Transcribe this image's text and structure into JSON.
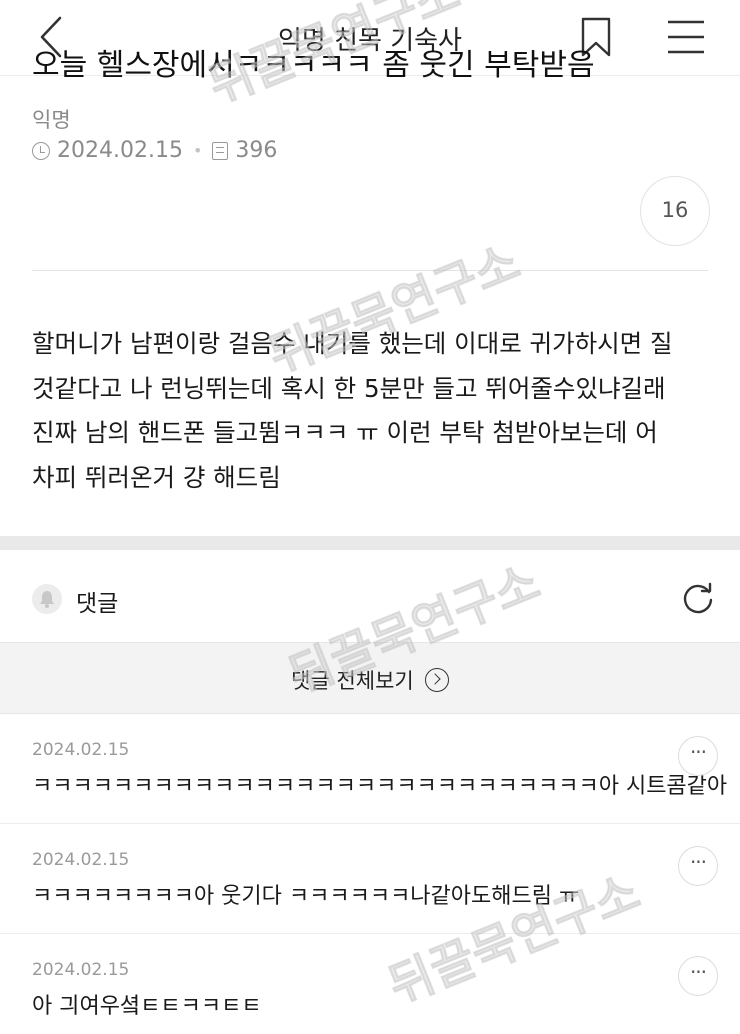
{
  "header": {
    "title": "익명 친목 기숙사",
    "back_icon": "back-arrow-icon",
    "bookmark_icon": "bookmark-icon",
    "menu_icon": "hamburger-menu-icon"
  },
  "post": {
    "title": "오늘 헬스장에서ㅋㅋㅋㅋㅋ 좀 웃긴 부탁받음",
    "author": "익명",
    "date": "2024.02.15",
    "views": "396",
    "comment_count": "16",
    "body_lines": [
      "할머니가 남편이랑 걸음수 내기를 했는데 이대로 귀가하시면 질",
      "것같다고 나 런닝뛰는데 혹시 한 5분만 들고 뛰어줄수있냐길래",
      "진짜 남의 핸드폰 들고뜀ㅋㅋㅋ ㅠ 이런 부탁 첨받아보는데 어",
      "차피 뛰러온거 걍 해드림"
    ]
  },
  "comments_section": {
    "label": "댓글",
    "view_all_label": "댓글 전체보기",
    "items": [
      {
        "date": "2024.02.15",
        "text": "ㅋㅋㅋㅋㅋㅋㅋㅋㅋㅋㅋㅋㅋㅋㅋㅋㅋㅋㅋㅋㅋㅋㅋㅋㅋㅋㅋㅋ아 시트콤같아",
        "more": "···"
      },
      {
        "date": "2024.02.15",
        "text": "ㅋㅋㅋㅋㅋㅋㅋㅋ아 웃기다 ㅋㅋㅋㅋㅋㅋ나같아도해드림 ㅠ",
        "more": "···"
      },
      {
        "date": "2024.02.15",
        "text": "아 긔여우셬ㅌㅌㅋㅋㅌㅌ",
        "more": "···"
      }
    ]
  },
  "watermark_text": "뒤끌묵연구소",
  "colors": {
    "background": "#ffffff",
    "divider": "#e9e9e9",
    "muted_text": "#8a8a8a",
    "view_all_bg": "#f3f3f3"
  }
}
